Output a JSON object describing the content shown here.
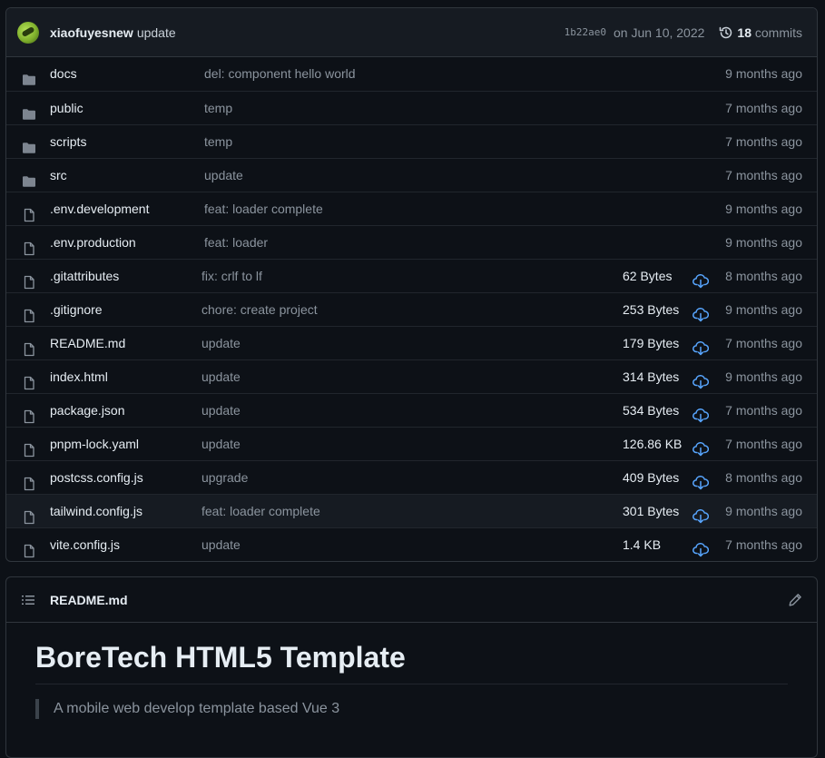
{
  "commit": {
    "author": "xiaofuyesnew",
    "message": "update",
    "sha": "1b22ae0",
    "date": "on Jun 10, 2022",
    "commit_count": "18",
    "commit_label": "commits"
  },
  "files": [
    {
      "type": "folder",
      "name": "docs",
      "message": "del: component hello world",
      "size": "",
      "age": "9 months ago"
    },
    {
      "type": "folder",
      "name": "public",
      "message": "temp",
      "size": "",
      "age": "7 months ago"
    },
    {
      "type": "folder",
      "name": "scripts",
      "message": "temp",
      "size": "",
      "age": "7 months ago"
    },
    {
      "type": "folder",
      "name": "src",
      "message": "update",
      "size": "",
      "age": "7 months ago"
    },
    {
      "type": "file",
      "name": ".env.development",
      "message": "feat: loader complete",
      "size": "",
      "age": "9 months ago"
    },
    {
      "type": "file",
      "name": ".env.production",
      "message": "feat: loader",
      "size": "",
      "age": "9 months ago"
    },
    {
      "type": "file",
      "name": ".gitattributes",
      "message": "fix: crlf to lf",
      "size": "62 Bytes",
      "age": "8 months ago"
    },
    {
      "type": "file",
      "name": ".gitignore",
      "message": "chore: create project",
      "size": "253 Bytes",
      "age": "9 months ago"
    },
    {
      "type": "file",
      "name": "README.md",
      "message": "update",
      "size": "179 Bytes",
      "age": "7 months ago"
    },
    {
      "type": "file",
      "name": "index.html",
      "message": "update",
      "size": "314 Bytes",
      "age": "9 months ago"
    },
    {
      "type": "file",
      "name": "package.json",
      "message": "update",
      "size": "534 Bytes",
      "age": "7 months ago"
    },
    {
      "type": "file",
      "name": "pnpm-lock.yaml",
      "message": "update",
      "size": "126.86 KB",
      "age": "7 months ago"
    },
    {
      "type": "file",
      "name": "postcss.config.js",
      "message": "upgrade",
      "size": "409 Bytes",
      "age": "8 months ago"
    },
    {
      "type": "file",
      "name": "tailwind.config.js",
      "message": "feat: loader complete",
      "size": "301 Bytes",
      "age": "9 months ago",
      "hover": true
    },
    {
      "type": "file",
      "name": "vite.config.js",
      "message": "update",
      "size": "1.4 KB",
      "age": "7 months ago"
    }
  ],
  "readme": {
    "filename": "README.md",
    "heading": "BoreTech HTML5 Template",
    "quote": "A mobile web develop template based Vue 3"
  },
  "colors": {
    "background": "#0d1117",
    "header": "#161b22",
    "border": "#30363d",
    "folder_icon": "#7d8590",
    "download_icon": "#58a6ff"
  },
  "icons": {
    "folder": "folder-icon",
    "file": "file-icon",
    "download": "cloud-download-icon",
    "history": "history-icon",
    "list": "list-unordered-icon",
    "edit": "pencil-icon"
  }
}
